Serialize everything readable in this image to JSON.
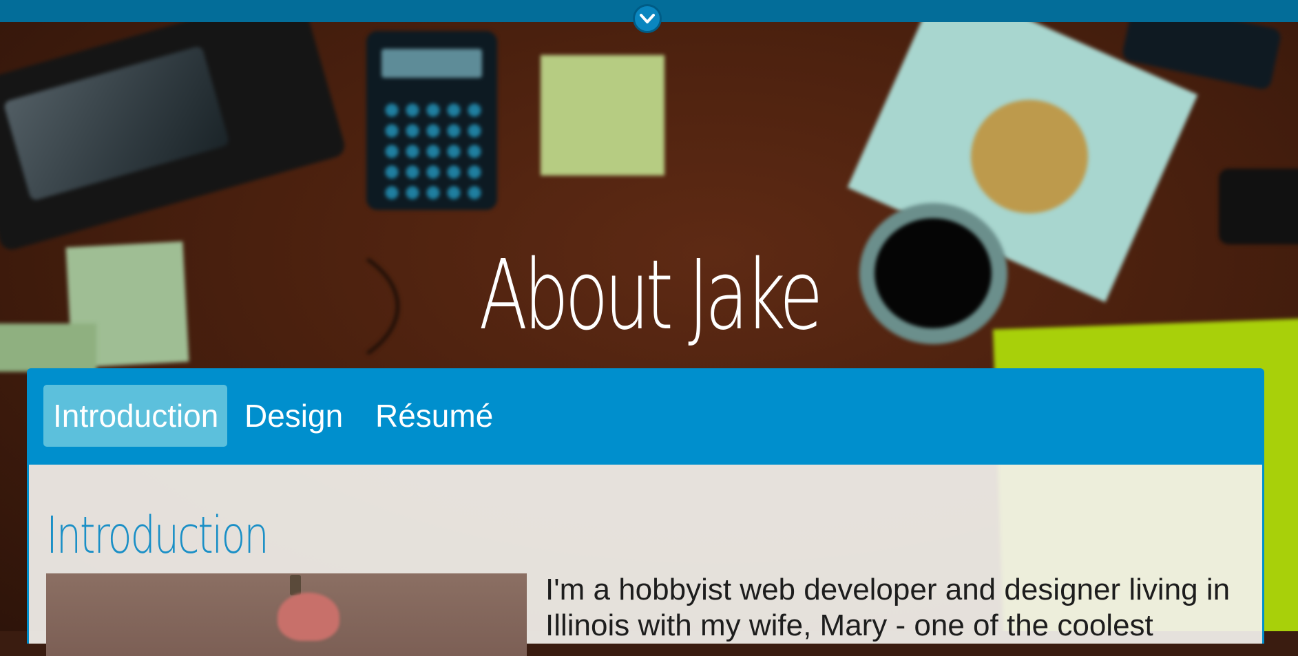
{
  "page": {
    "title": "About Jake"
  },
  "topbar": {
    "scroll_icon": "chevron-down-icon"
  },
  "tabs": [
    {
      "label": "Introduction",
      "active": true
    },
    {
      "label": "Design",
      "active": false
    },
    {
      "label": "Résumé",
      "active": false
    }
  ],
  "content": {
    "heading": "Introduction",
    "body": "I'm a hobbyist web developer and designer living in Illinois with my wife, Mary - one of the coolest"
  },
  "colors": {
    "topbar": "#036d99",
    "tabbar": "#008fcd",
    "active_tab": "#5cc0dc",
    "heading": "#1a8fc6"
  }
}
